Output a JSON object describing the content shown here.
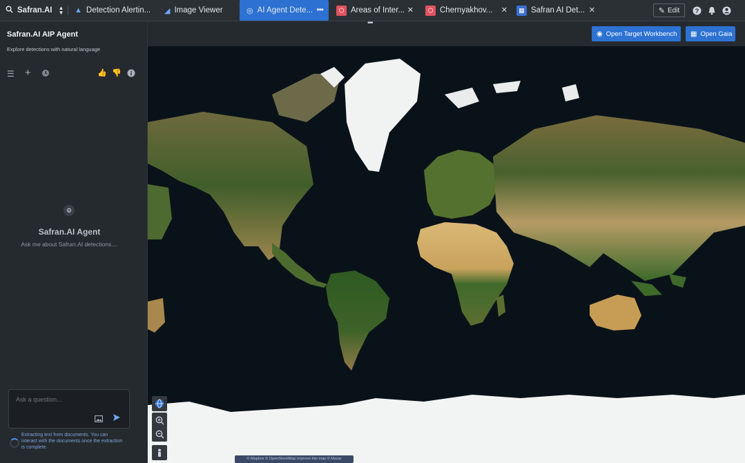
{
  "tabs": {
    "app_label": "Safran.AI",
    "detection_alerting": "Detection Alertin...",
    "image_viewer": "Image Viewer",
    "ai_agent": "AI Agent Dete...",
    "areas_of_interest": "Areas of Inter...",
    "chernyakhov": "Chernyakhov...",
    "safran_ai_det": "Safran AI Det..."
  },
  "toolbar": {
    "edit_label": "Edit"
  },
  "header": {
    "title": "Safran.AI AIP Agent",
    "subtitle": "Explore detections with natural language",
    "open_target_workbench": "Open Target Workbench",
    "open_gaia": "Open Gaia"
  },
  "agent": {
    "name": "Safran.AI Agent",
    "prompt": "Ask me about Safran.AI detections....",
    "input_placeholder": "Ask a question...",
    "status_text": "Extracting text from documents. You can interact with the documents once the extraction is complete."
  },
  "map": {
    "footer_text": "© Mapbox © OpenStreetMap Improve this map © Maxar"
  },
  "colors": {
    "accent": "#2d72d2",
    "background": "#1f2327",
    "panel": "#252a2f",
    "ocean": "#0a1219"
  }
}
